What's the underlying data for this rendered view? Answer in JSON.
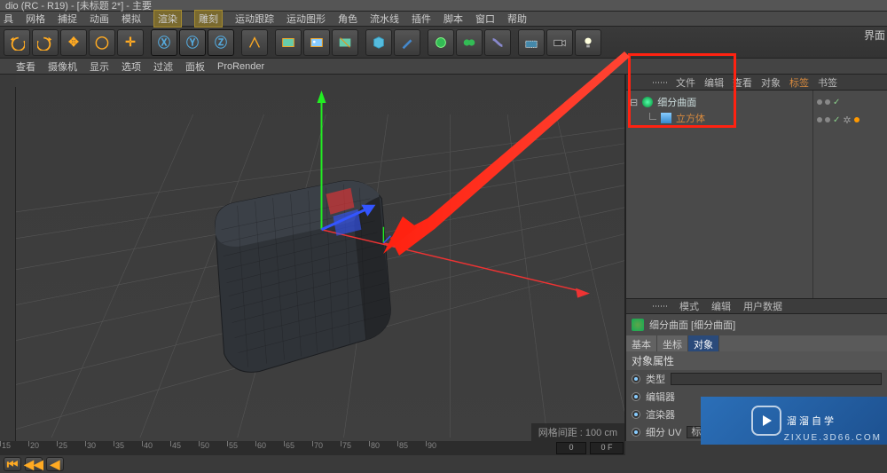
{
  "title": "dio (RC - R19) - [未标题 2*] - 主要",
  "interface_label": "界面",
  "menu": [
    "具",
    "网格",
    "捕捉",
    "动画",
    "模拟",
    "渲染",
    "雕刻",
    "运动跟踪",
    "运动图形",
    "角色",
    "流水线",
    "插件",
    "脚本",
    "窗口",
    "帮助"
  ],
  "highlight_index1": 5,
  "highlight_index2": 6,
  "viewport_menu": [
    "查看",
    "摄像机",
    "显示",
    "选项",
    "过滤",
    "面板",
    "ProRender"
  ],
  "status": "网格间距 : 100 cm",
  "timeline_ticks": [
    "15",
    "20",
    "25",
    "30",
    "35",
    "40",
    "45",
    "50",
    "55",
    "60",
    "65",
    "70",
    "75",
    "80",
    "85",
    "90"
  ],
  "timeline_frame_a": "0",
  "timeline_frame_b": "0 F",
  "panel_top_tabs": [
    "文件",
    "编辑",
    "查看",
    "对象",
    "标签",
    "书签"
  ],
  "panel_top_active": "标签",
  "tree": {
    "parent": "细分曲面",
    "child": "立方体"
  },
  "attr_tabs": [
    "模式",
    "编辑",
    "用户数据"
  ],
  "attr_header": "细分曲面 [细分曲面]",
  "attr_sub_tabs": [
    "基本",
    "坐标",
    "对象"
  ],
  "attr_sub_active": 2,
  "attr_section": "对象属性",
  "attr_rows": [
    {
      "label": "类型"
    },
    {
      "label": "编辑器"
    },
    {
      "label": "渲染器"
    },
    {
      "label": "细分 UV",
      "value": "标准"
    }
  ],
  "watermark_text": "溜溜自学",
  "watermark_url": "ZIXUE.3D66.COM"
}
